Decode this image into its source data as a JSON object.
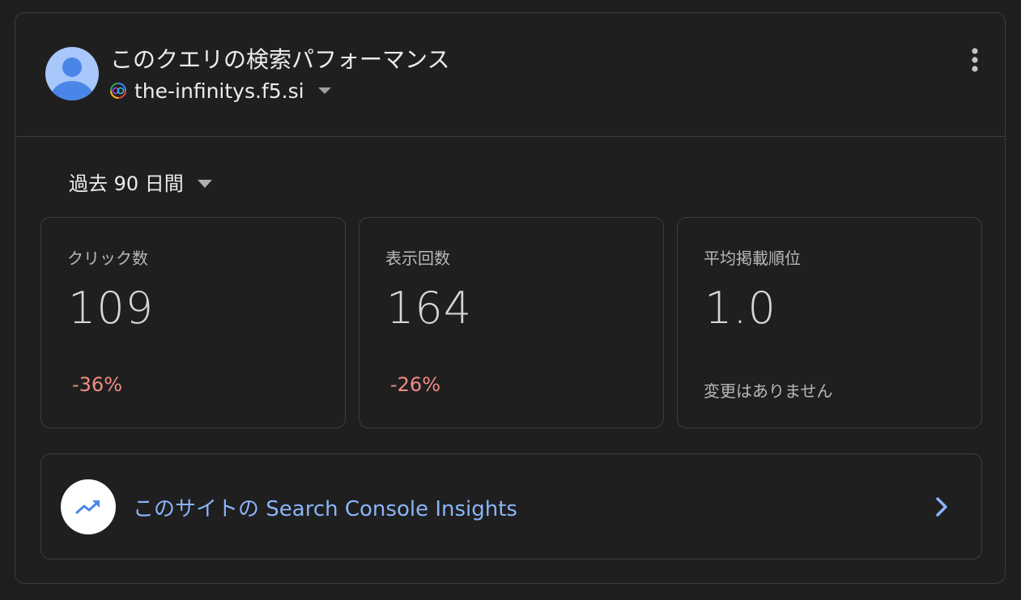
{
  "header": {
    "title": "このクエリの検索パフォーマンス",
    "site": "the-infinitys.f5.si",
    "avatar_icon": "account-avatar-icon",
    "more_icon": "more-vert-icon"
  },
  "range": {
    "label": "過去 90 日間"
  },
  "metrics": [
    {
      "label": "クリック数",
      "value": "109",
      "change": "-36%"
    },
    {
      "label": "表示回数",
      "value": "164",
      "change": "-26%"
    },
    {
      "label": "平均掲載順位",
      "value": "1.0",
      "change": "変更はありません"
    }
  ],
  "insights": {
    "label": "このサイトの Search Console Insights",
    "icon": "trending-up-icon"
  },
  "colors": {
    "background": "#1e1e1f",
    "border": "#3c3d40",
    "negative": "#f28b82",
    "link": "#8ab4f8",
    "avatar_bg": "#a8c7fa",
    "avatar_fg": "#4a86e8"
  }
}
